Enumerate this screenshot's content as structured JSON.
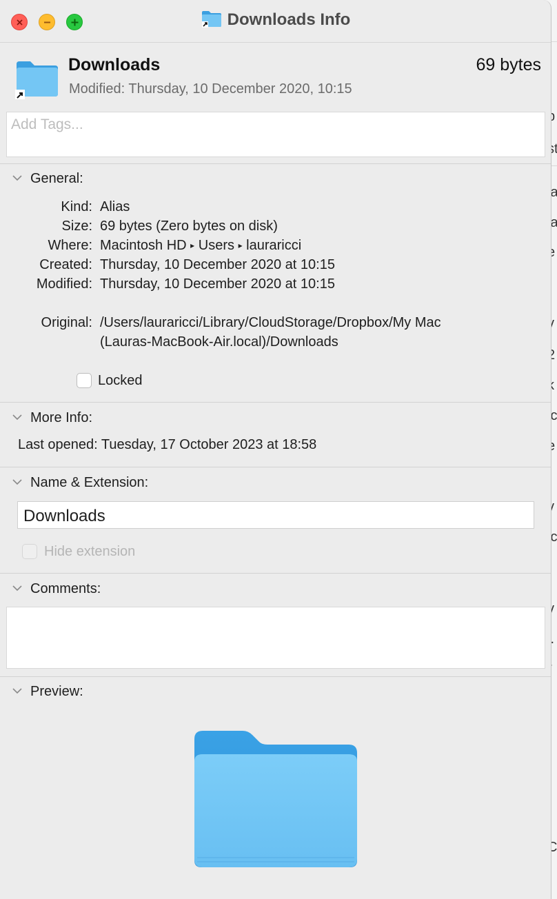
{
  "window": {
    "title": "Downloads Info"
  },
  "header": {
    "name": "Downloads",
    "size": "69 bytes",
    "modified_label": "Modified:",
    "modified_value": "Thursday, 10 December 2020, 10:15"
  },
  "tags": {
    "placeholder": "Add Tags..."
  },
  "general": {
    "title": "General:",
    "kind_label": "Kind:",
    "kind_value": "Alias",
    "size_label": "Size:",
    "size_value": "69 bytes (Zero bytes on disk)",
    "where_label": "Where:",
    "where_path": [
      "Macintosh HD",
      "Users",
      "lauraricci"
    ],
    "created_label": "Created:",
    "created_value": "Thursday, 10 December 2020 at 10:15",
    "modified_label": "Modified:",
    "modified_value": "Thursday, 10 December 2020 at 10:15",
    "original_label": "Original:",
    "original_line1": "/Users/lauraricci/Library/CloudStorage/Dropbox/My Mac",
    "original_line2": "(Lauras-MacBook-Air.local)/Downloads",
    "locked_label": "Locked"
  },
  "more_info": {
    "title": "More Info:",
    "last_opened_label": "Last opened:",
    "last_opened_value": "Tuesday, 17 October 2023 at 18:58"
  },
  "name_extension": {
    "title": "Name & Extension:",
    "value": "Downloads",
    "hide_extension_label": "Hide extension"
  },
  "comments": {
    "title": "Comments:",
    "value": ""
  },
  "preview": {
    "title": "Preview:"
  },
  "background_app": {
    "fragments": [
      "p",
      "st",
      "ia",
      "ia",
      "e",
      "v",
      "2",
      "k",
      "ic",
      "e",
      "v",
      "n",
      "lc",
      "v",
      "l.",
      "r",
      "C"
    ]
  },
  "colors": {
    "folder_light": "#74c6f4",
    "folder_dark": "#3b9fe0",
    "close": "#ff5f57",
    "minimize": "#febc2e",
    "zoom": "#28c840"
  }
}
